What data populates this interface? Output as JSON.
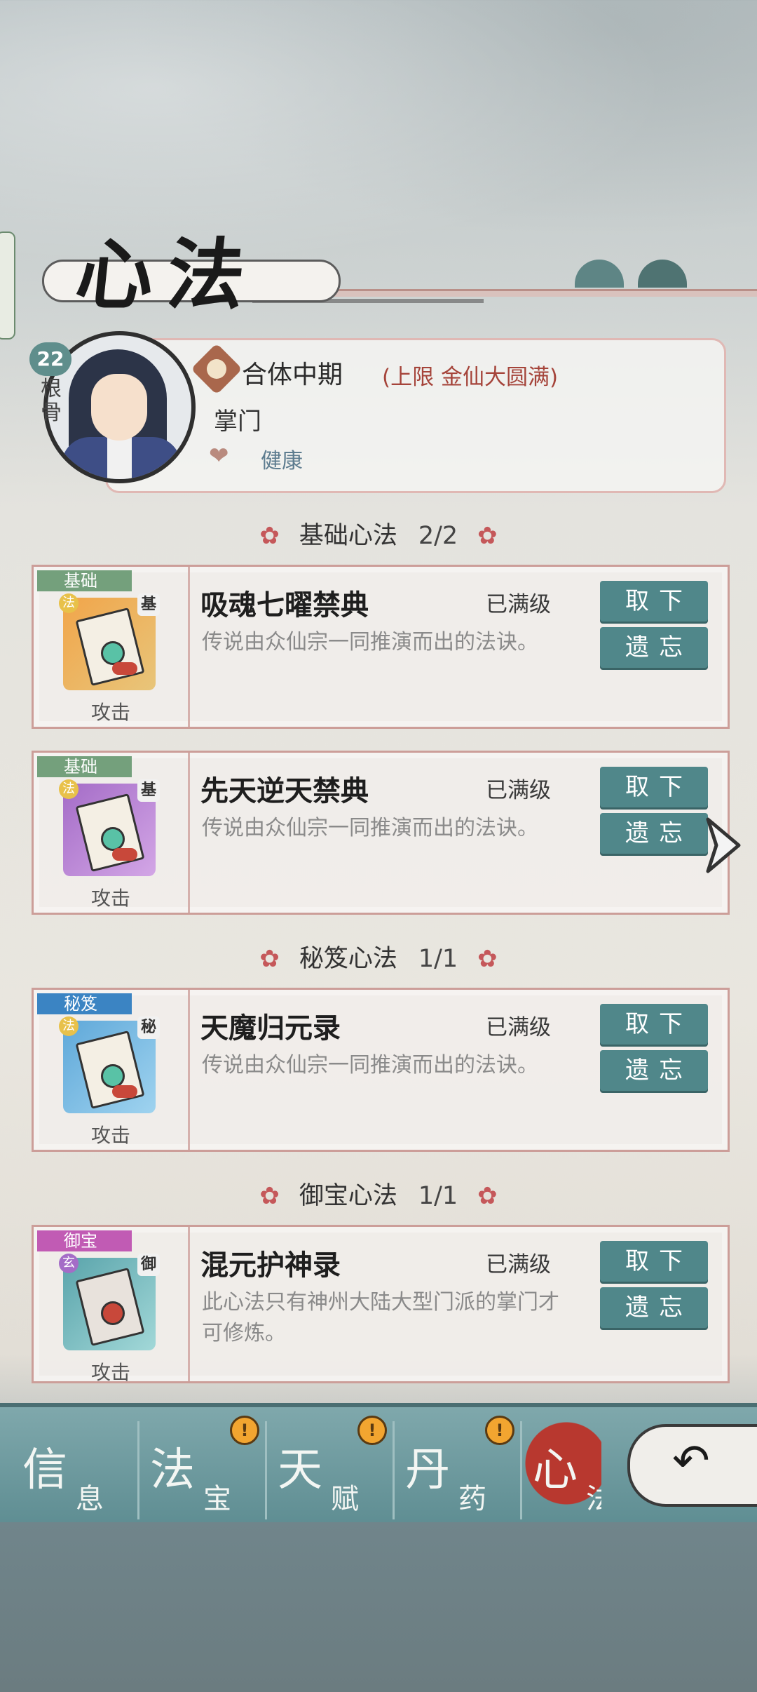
{
  "page": {
    "title": "心法"
  },
  "profile": {
    "level": "22",
    "root_label": "根骨",
    "realm": "合体中期",
    "realm_limit": "(上限 金仙大圆满)",
    "role": "掌门",
    "health": "健康"
  },
  "sections": {
    "basic": {
      "label": "基础心法",
      "count": "2/2"
    },
    "secret": {
      "label": "秘笈心法",
      "count": "1/1"
    },
    "treasure": {
      "label": "御宝心法",
      "count": "1/1"
    }
  },
  "skills": [
    {
      "tag": "基础",
      "corner": "基",
      "name": "吸魂七曜禁典",
      "status": "已满级",
      "description": "传说由众仙宗一同推演而出的法诀。",
      "type": "攻击",
      "take_label": "取下",
      "forget_label": "遗忘"
    },
    {
      "tag": "基础",
      "corner": "基",
      "name": "先天逆天禁典",
      "status": "已满级",
      "description": "传说由众仙宗一同推演而出的法诀。",
      "type": "攻击",
      "take_label": "取下",
      "forget_label": "遗忘"
    },
    {
      "tag": "秘笈",
      "corner": "秘",
      "name": "天魔归元录",
      "status": "已满级",
      "description": "传说由众仙宗一同推演而出的法诀。",
      "type": "攻击",
      "take_label": "取下",
      "forget_label": "遗忘"
    },
    {
      "tag": "御宝",
      "corner": "御",
      "name": "混元护神录",
      "status": "已满级",
      "description": "此心法只有神州大陆大型门派的掌门才可修炼。",
      "type": "攻击",
      "take_label": "取下",
      "forget_label": "遗忘"
    }
  ],
  "nav": [
    {
      "big": "信",
      "small": "息",
      "alert": false
    },
    {
      "big": "法",
      "small": "宝",
      "alert": true
    },
    {
      "big": "天",
      "small": "赋",
      "alert": true
    },
    {
      "big": "丹",
      "small": "药",
      "alert": true
    },
    {
      "big": "心",
      "small": "法",
      "alert": false,
      "active": true
    }
  ],
  "icons": {
    "flower": "✿",
    "alert": "!",
    "heart": "❤",
    "back": "↶",
    "next": "❯"
  },
  "colors": {
    "button": "#50878a",
    "realm_limit": "#a5443a",
    "tag_basic": "#74a07c",
    "tag_secret": "#3b84c3",
    "tag_treasure": "#c15bb4"
  }
}
